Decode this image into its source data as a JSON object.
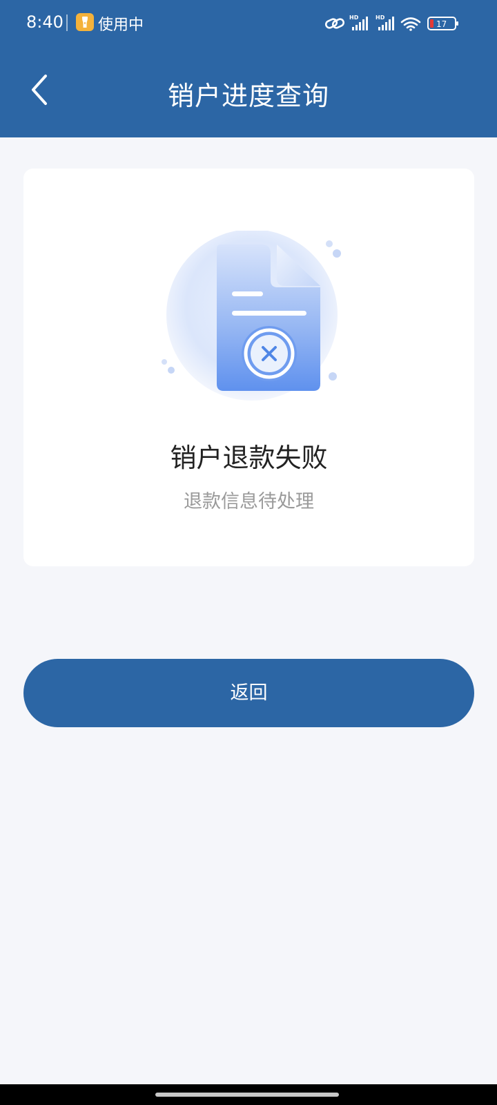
{
  "status_bar": {
    "time": "8:40",
    "flashlight_text": "使用中",
    "battery": "17"
  },
  "header": {
    "title": "销户进度查询"
  },
  "result": {
    "title": "销户退款失败",
    "subtitle": "退款信息待处理"
  },
  "actions": {
    "return_label": "返回"
  },
  "colors": {
    "primary": "#2c66a5",
    "background": "#f5f6fa"
  }
}
